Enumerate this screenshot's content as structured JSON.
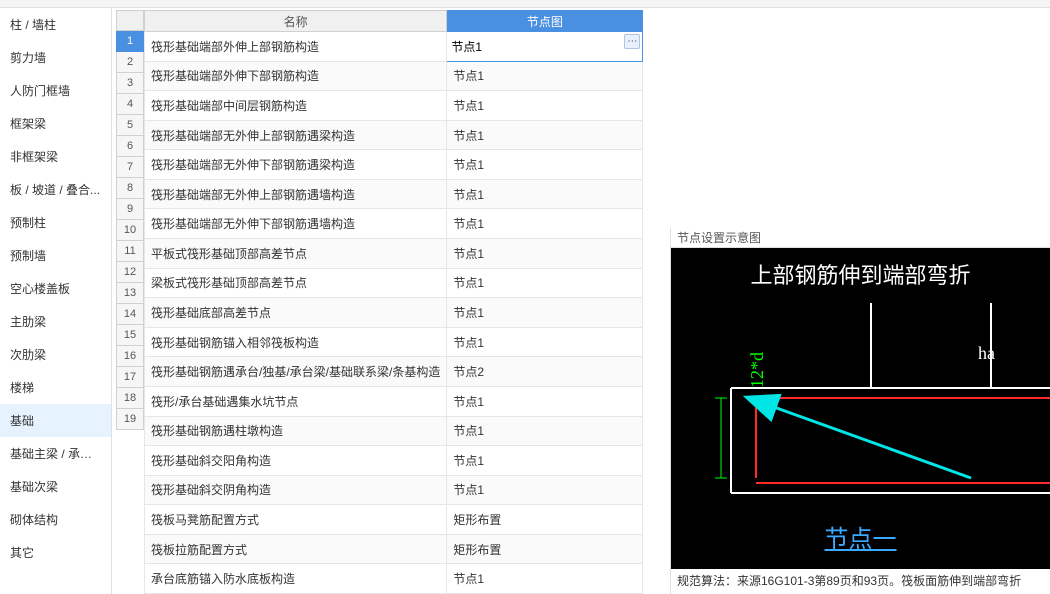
{
  "sidebar": {
    "items": [
      {
        "label": "柱 / 墙柱"
      },
      {
        "label": "剪力墙"
      },
      {
        "label": "人防门框墙"
      },
      {
        "label": "框架梁"
      },
      {
        "label": "非框架梁"
      },
      {
        "label": "板 / 坡道 / 叠合..."
      },
      {
        "label": "预制柱"
      },
      {
        "label": "预制墙"
      },
      {
        "label": "空心楼盖板"
      },
      {
        "label": "主肋梁"
      },
      {
        "label": "次肋梁"
      },
      {
        "label": "楼梯"
      },
      {
        "label": "基础"
      },
      {
        "label": "基础主梁 / 承台梁"
      },
      {
        "label": "基础次梁"
      },
      {
        "label": "砌体结构"
      },
      {
        "label": "其它"
      }
    ],
    "activeIndex": 12
  },
  "grid": {
    "headers": {
      "name": "名称",
      "node": "节点图"
    },
    "selectedRow": 1,
    "editValue": "节点1",
    "rows": [
      {
        "name": "筏形基础端部外伸上部钢筋构造",
        "node": "节点1"
      },
      {
        "name": "筏形基础端部外伸下部钢筋构造",
        "node": "节点1"
      },
      {
        "name": "筏形基础端部中间层钢筋构造",
        "node": "节点1"
      },
      {
        "name": "筏形基础端部无外伸上部钢筋遇梁构造",
        "node": "节点1"
      },
      {
        "name": "筏形基础端部无外伸下部钢筋遇梁构造",
        "node": "节点1"
      },
      {
        "name": "筏形基础端部无外伸上部钢筋遇墙构造",
        "node": "节点1"
      },
      {
        "name": "筏形基础端部无外伸下部钢筋遇墙构造",
        "node": "节点1"
      },
      {
        "name": "平板式筏形基础顶部高差节点",
        "node": "节点1"
      },
      {
        "name": "梁板式筏形基础顶部高差节点",
        "node": "节点1"
      },
      {
        "name": "筏形基础底部高差节点",
        "node": "节点1"
      },
      {
        "name": "筏形基础钢筋锚入相邻筏板构造",
        "node": "节点1"
      },
      {
        "name": "筏形基础钢筋遇承台/独基/承台梁/基础联系梁/条基构造",
        "node": "节点2"
      },
      {
        "name": "筏形/承台基础遇集水坑节点",
        "node": "节点1"
      },
      {
        "name": "筏形基础钢筋遇柱墩构造",
        "node": "节点1"
      },
      {
        "name": "筏形基础斜交阳角构造",
        "node": "节点1"
      },
      {
        "name": "筏形基础斜交阴角构造",
        "node": "节点1"
      },
      {
        "name": "筏板马凳筋配置方式",
        "node": "矩形布置"
      },
      {
        "name": "筏板拉筋配置方式",
        "node": "矩形布置"
      },
      {
        "name": "承台底筋锚入防水底板构造",
        "node": "节点1"
      }
    ]
  },
  "rightpanel": {
    "title": "节点设置示意图",
    "diagram": {
      "topText": "上部钢筋伸到端部弯折",
      "ha": "ha",
      "v12d": "12*d",
      "bottomText": "节点一"
    },
    "footnote": "规范算法：来源16G101-3第89页和93页。筏板面筋伸到端部弯折"
  },
  "icons": {
    "ellipsis": "⋯"
  }
}
